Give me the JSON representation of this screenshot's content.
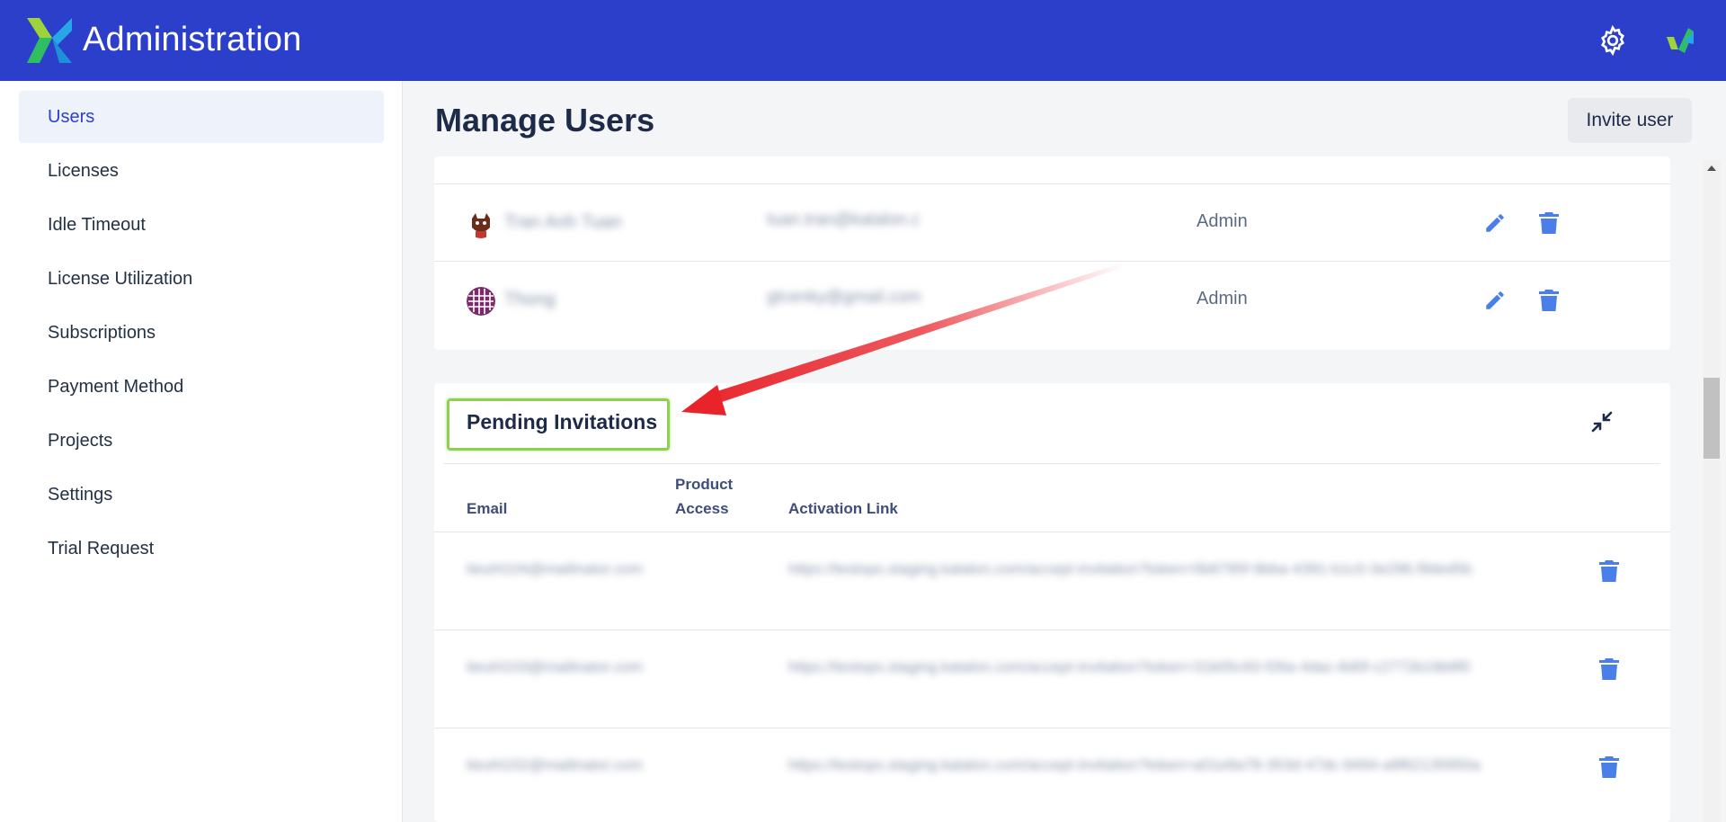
{
  "app": {
    "title": "Administration"
  },
  "sidebar": {
    "items": [
      {
        "label": "Users",
        "active": true
      },
      {
        "label": "Licenses"
      },
      {
        "label": "Idle Timeout"
      },
      {
        "label": "License Utilization"
      },
      {
        "label": "Subscriptions"
      },
      {
        "label": "Payment Method"
      },
      {
        "label": "Projects"
      },
      {
        "label": "Settings"
      },
      {
        "label": "Trial Request"
      }
    ]
  },
  "main": {
    "title": "Manage Users",
    "invite_button": "Invite user"
  },
  "users": [
    {
      "name": "Tran Anh Tuan",
      "email": "tuan.tran@katalon.c",
      "role": "Admin"
    },
    {
      "name": "Thong",
      "email": "gtcenky@gmail.com",
      "role": "Admin"
    }
  ],
  "pending": {
    "title": "Pending Invitations",
    "columns": {
      "email": "Email",
      "product_access": "Product Access",
      "activation_link": "Activation Link"
    },
    "rows": [
      {
        "email": "tieuhl104@mailinator.com",
        "link": "https://testops.staging.katalon.com/accept-invitation?token=0b8795f-9bba-4391-b1c0-3e296.f9ded5b"
      },
      {
        "email": "tieuhl103@mailinator.com",
        "link": "https://testops.staging.katalon.com/accept-invitation?token=31b05c93-f26a-4dac-8d0f-c2772b19b8f0"
      },
      {
        "email": "tieuhl102@mailinator.com",
        "link": "https://testops.staging.katalon.com/accept-invitation?token=a01e8a78-353d-47dc-9494-a9f62135950a"
      }
    ]
  },
  "colors": {
    "header": "#2b3fcb",
    "accent": "#4a7ee8",
    "highlight_box": "#8fd14f",
    "arrow": "#e8232a"
  }
}
